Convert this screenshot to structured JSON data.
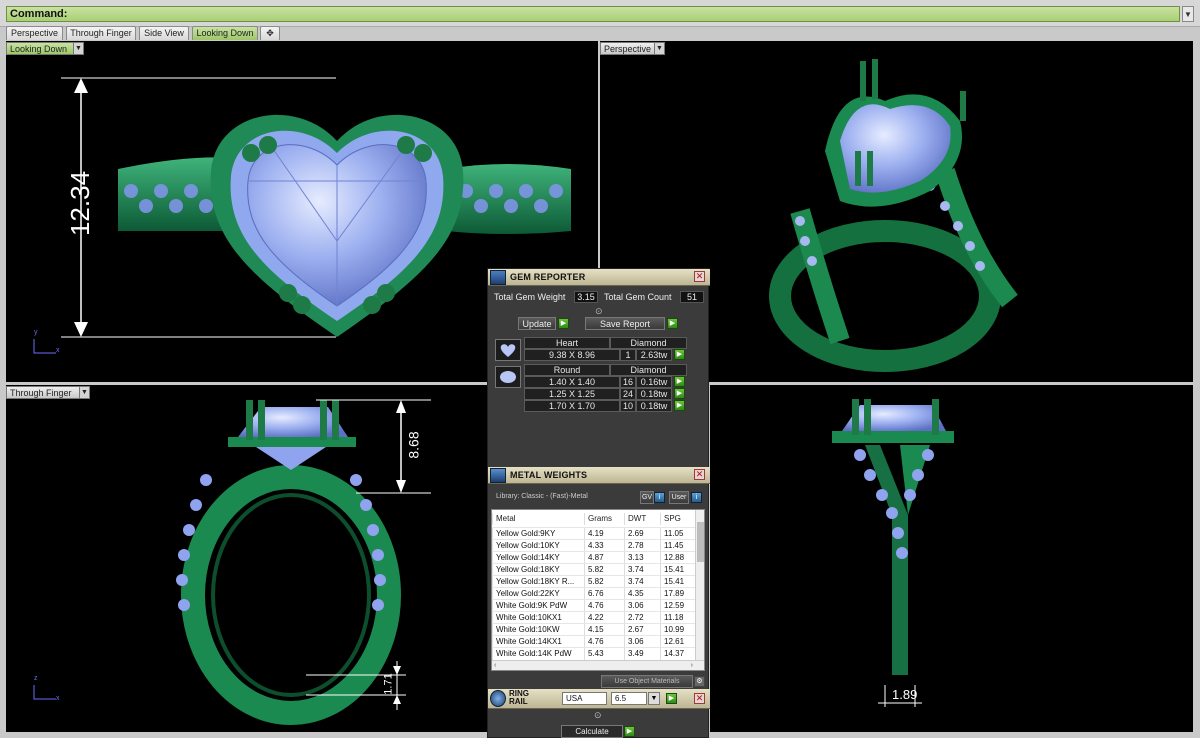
{
  "command": {
    "label": "Command:"
  },
  "tabs": [
    "Perspective",
    "Through Finger",
    "Side View",
    "Looking Down"
  ],
  "tab_add": "✥",
  "viewports": {
    "top_left": {
      "label": "Looking Down",
      "dimension": "12.34",
      "axis_x": "x",
      "axis_y": "y"
    },
    "top_right": {
      "label": "Perspective"
    },
    "bottom_left": {
      "label": "Through Finger",
      "dimension_height": "8.68",
      "dimension_band": "1.71",
      "axis_x": "x",
      "axis_z": "z"
    },
    "bottom_right": {
      "dimension_width": "1.89"
    }
  },
  "gem_reporter": {
    "title": "GEM REPORTER",
    "total_gem_weight_label": "Total Gem Weight",
    "total_gem_weight": "3.15",
    "total_gem_count_label": "Total Gem Count",
    "total_gem_count": "51",
    "update_label": "Update",
    "save_report_label": "Save Report",
    "groups": [
      {
        "shape": "Heart",
        "material": "Diamond",
        "rows": [
          {
            "size": "9.38 X 8.96",
            "count": "1",
            "weight": "2.63tw"
          }
        ]
      },
      {
        "shape": "Round",
        "material": "Diamond",
        "rows": [
          {
            "size": "1.40 X 1.40",
            "count": "16",
            "weight": "0.16tw"
          },
          {
            "size": "1.25 X 1.25",
            "count": "24",
            "weight": "0.18tw"
          },
          {
            "size": "1.70 X 1.70",
            "count": "10",
            "weight": "0.18tw"
          }
        ]
      }
    ]
  },
  "metal_weights": {
    "title": "METAL WEIGHTS",
    "library_label": "Library: Classic - (Fast)-Metal",
    "gv_label": "GV",
    "user_label": "User",
    "columns": [
      "Metal",
      "Grams",
      "DWT",
      "SPG"
    ],
    "rows": [
      [
        "Yellow Gold:9KY",
        "4.19",
        "2.69",
        "11.05"
      ],
      [
        "Yellow Gold:10KY",
        "4.33",
        "2.78",
        "11.45"
      ],
      [
        "Yellow Gold:14KY",
        "4.87",
        "3.13",
        "12.88"
      ],
      [
        "Yellow Gold:18KY",
        "5.82",
        "3.74",
        "15.41"
      ],
      [
        "Yellow Gold:18KY R...",
        "5.82",
        "3.74",
        "15.41"
      ],
      [
        "Yellow Gold:22KY",
        "6.76",
        "4.35",
        "17.89"
      ],
      [
        "White Gold:9K PdW",
        "4.76",
        "3.06",
        "12.59"
      ],
      [
        "White Gold:10KX1",
        "4.22",
        "2.72",
        "11.18"
      ],
      [
        "White Gold:10KW",
        "4.15",
        "2.67",
        "10.99"
      ],
      [
        "White Gold:14KX1",
        "4.76",
        "3.06",
        "12.61"
      ],
      [
        "White Gold:14K PdW",
        "5.43",
        "3.49",
        "14.37"
      ]
    ],
    "use_object_materials": "Use Object Materials"
  },
  "ring_rail": {
    "title": "RING RAIL",
    "region": "USA",
    "size": "6.5",
    "calculate_label": "Calculate"
  }
}
